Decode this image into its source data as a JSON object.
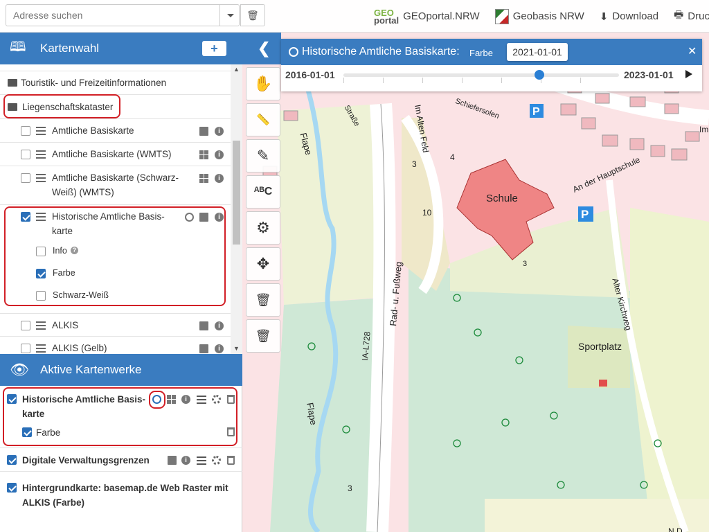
{
  "search": {
    "placeholder": "Adresse suchen"
  },
  "toplinks": [
    {
      "brand_a": "GEO",
      "brand_b": "portal",
      "label": "GEOportal.NRW"
    },
    {
      "label": "Geobasis NRW"
    },
    {
      "label": "Download"
    },
    {
      "label": "Druck"
    }
  ],
  "kartenwahl": {
    "title": "Kartenwahl",
    "add": "+",
    "collapse": "❮"
  },
  "tree": {
    "touristik": "Touristik- und Freizeitinformationen",
    "liegenschaft": "Liegenschaftskataster",
    "items": [
      {
        "label": "Amtliche Basiskarte"
      },
      {
        "label": "Amtliche Basiskarte (WMTS)"
      },
      {
        "label": "Amtliche Basiskarte (Schwarz-\nWeiß) (WMTS)"
      },
      {
        "label": "Historische Amtliche Basis-\nkarte"
      },
      {
        "label": "ALKIS"
      },
      {
        "label": "ALKIS (Gelb)"
      }
    ],
    "sub": {
      "info": "Info",
      "farbe": "Farbe",
      "sw": "Schwarz-Weiß"
    }
  },
  "active": {
    "title": "Aktive Kartenwerke",
    "items": [
      {
        "label": "Historische Amtliche Basis-\nkarte",
        "sub": "Farbe"
      },
      {
        "label": "Digitale Verwaltungsgrenzen"
      },
      {
        "label": "Hintergrundkarte: basemap.de Web Raster mit\nALKIS (Farbe)"
      }
    ]
  },
  "timepanel": {
    "title": "Historische Amtliche Basiskarte:",
    "variant": "Farbe",
    "current": "2021-01-01",
    "start": "2016-01-01",
    "end": "2023-01-01",
    "position": 0.71
  },
  "map": {
    "labels": [
      "Schule",
      "Sportplatz",
      "An der Hauptschule",
      "Im Alten Feld",
      "Alter Kirchweg",
      "Rad- u. Fußweg",
      "IA-L728",
      "Flape",
      "Flape",
      "Schiefersolen",
      "Straße",
      "Im",
      "10",
      "4",
      "3",
      "3",
      "3",
      "N D"
    ]
  }
}
